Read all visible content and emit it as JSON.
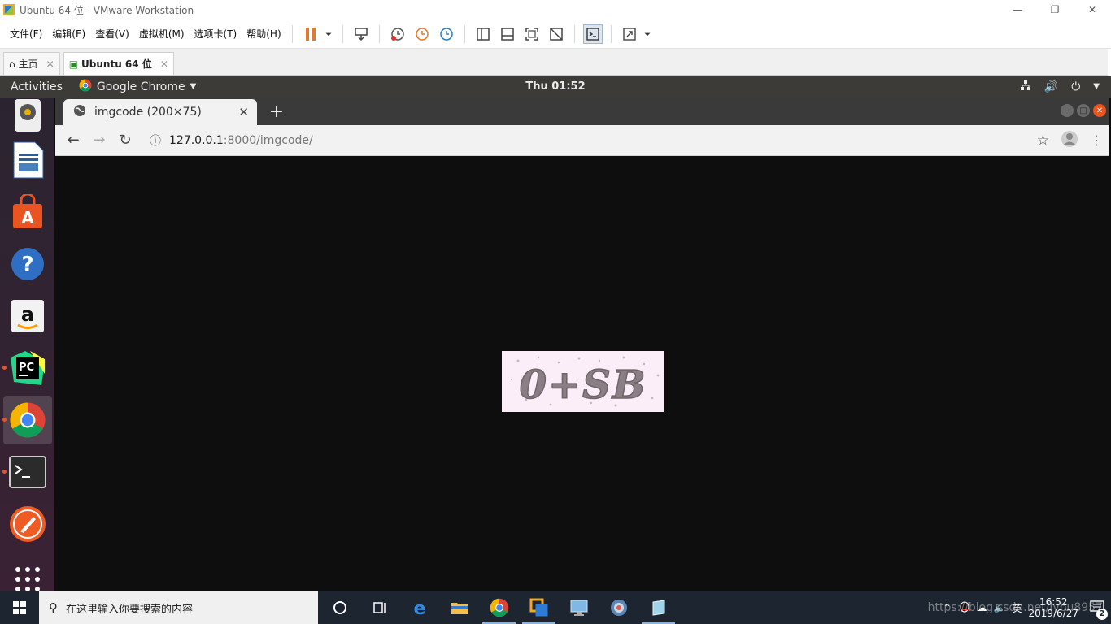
{
  "vmware": {
    "title": "Ubuntu 64 位 - VMware Workstation",
    "menus": [
      "文件(F)",
      "编辑(E)",
      "查看(V)",
      "虚拟机(M)",
      "选项卡(T)",
      "帮助(H)"
    ],
    "tabs": [
      {
        "label": "主页"
      },
      {
        "label": "Ubuntu 64 位"
      }
    ]
  },
  "ubuntu": {
    "activities": "Activities",
    "app_menu": "Google Chrome",
    "clock": "Thu 01:52"
  },
  "chrome": {
    "tab_title": "imgcode (200×75)",
    "url_host": "127.0.0.1",
    "url_path": ":8000/imgcode/"
  },
  "captcha": {
    "text": "0+SB"
  },
  "taskbar": {
    "search_placeholder": "在这里输入你要搜索的内容",
    "ime": "英",
    "time": "16:52",
    "date": "2019/6/27",
    "notifications": "2",
    "watermark": "https://blog.csdn.net/lybu8957"
  }
}
